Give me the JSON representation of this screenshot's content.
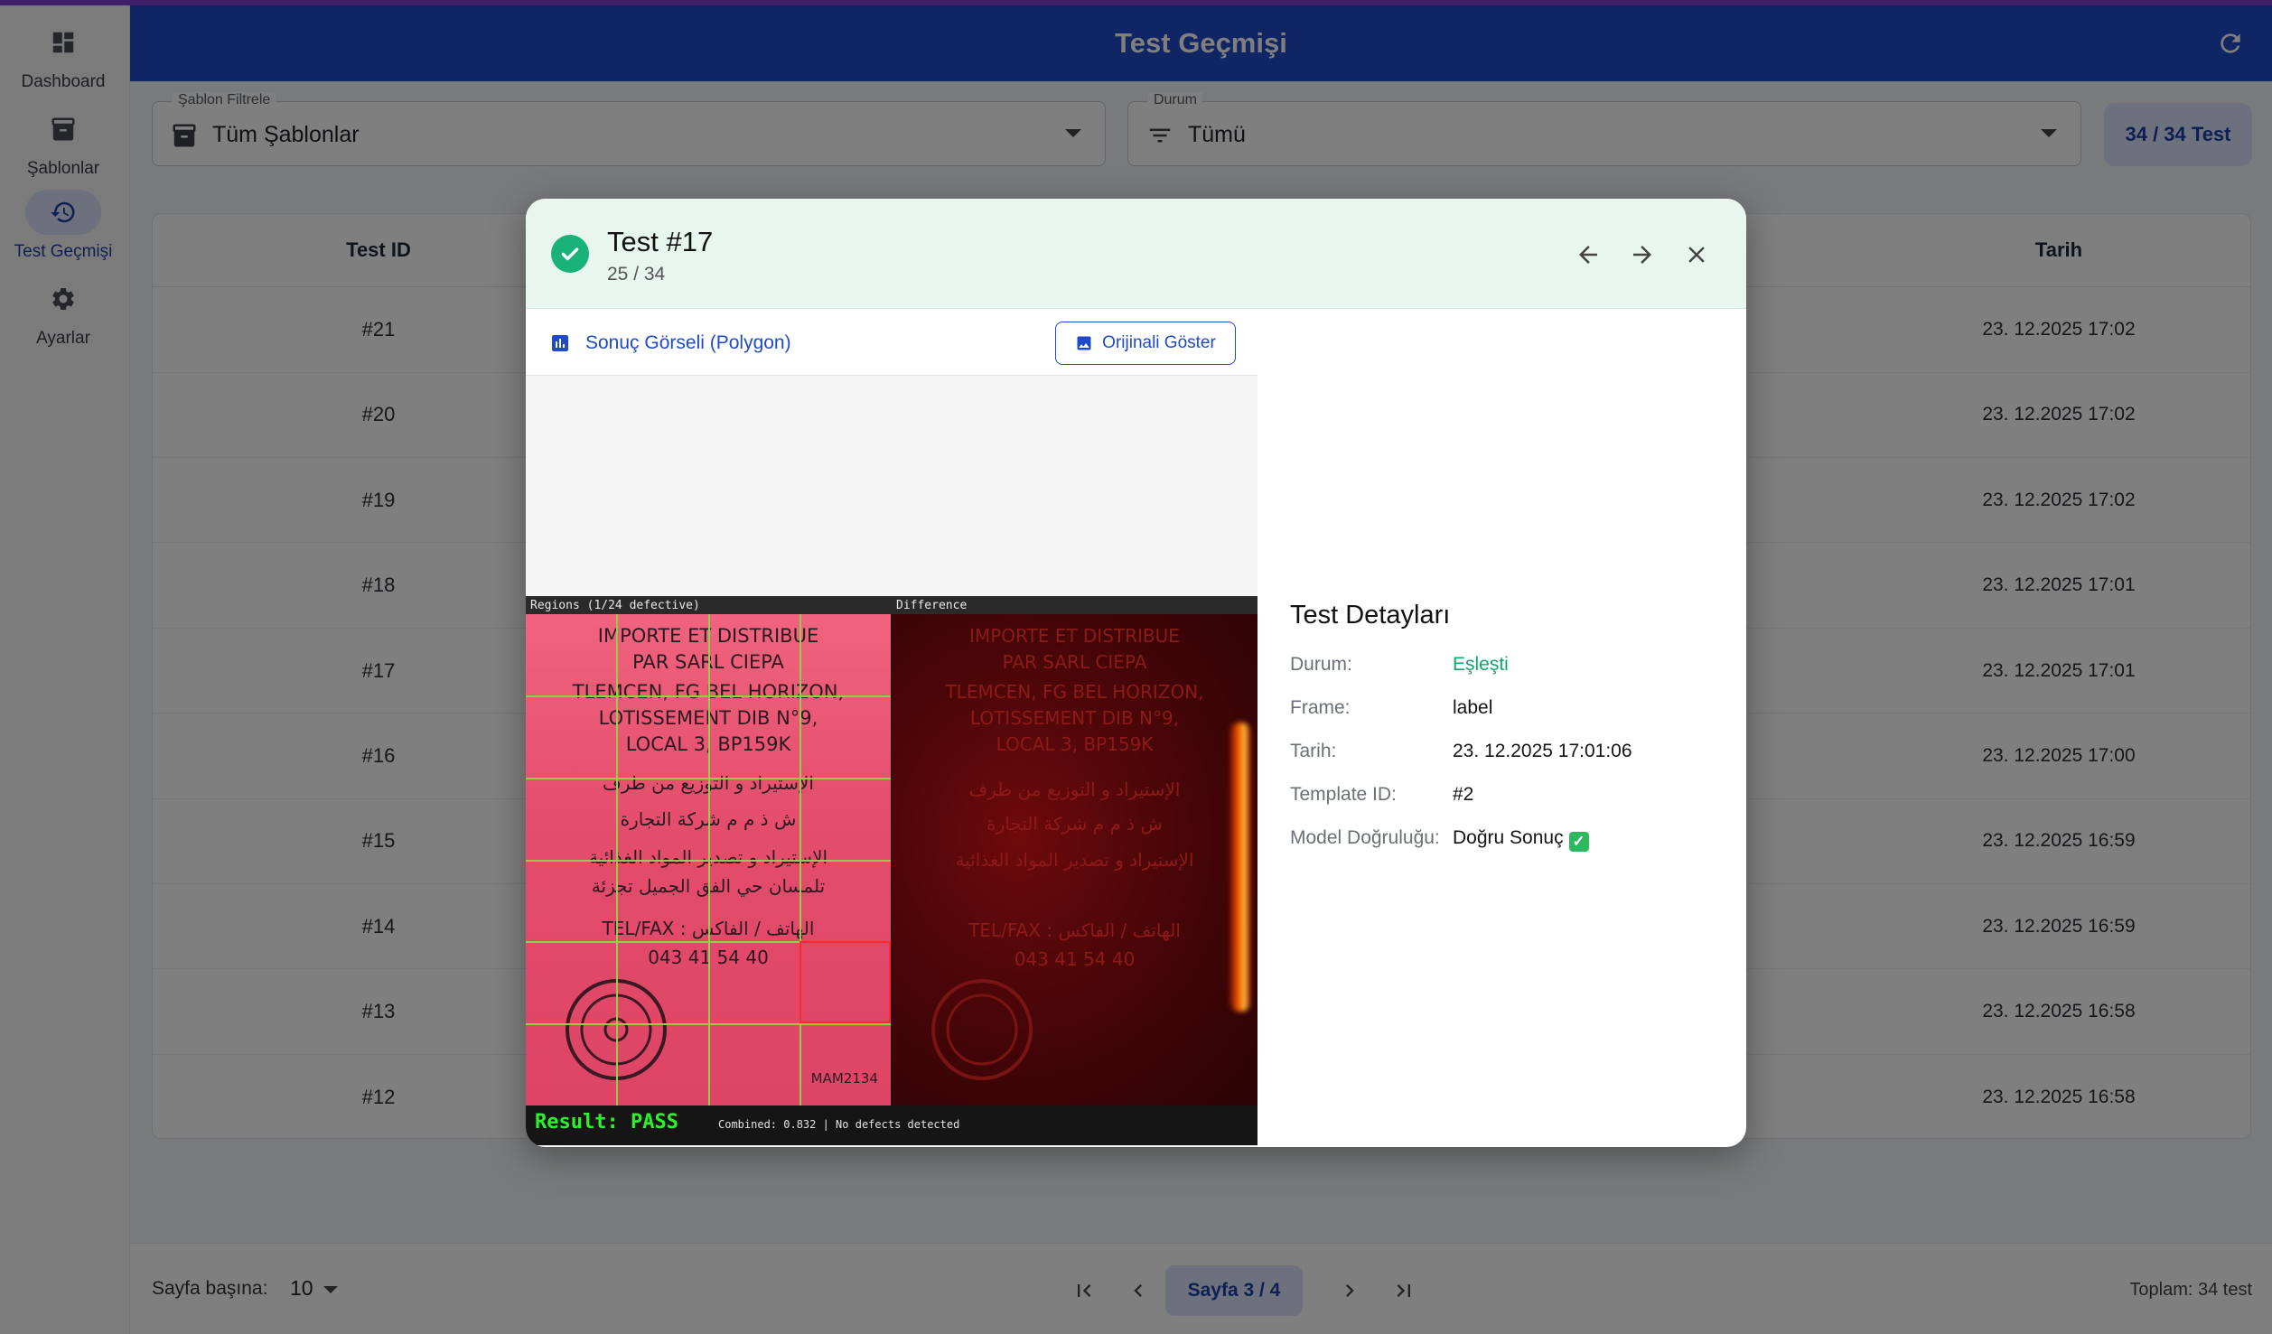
{
  "app": {
    "header_title": "Test Geçmişi"
  },
  "sidebar": {
    "items": [
      {
        "label": "Dashboard",
        "icon": "dashboard-icon",
        "active": false
      },
      {
        "label": "Şablonlar",
        "icon": "archive-icon",
        "active": false
      },
      {
        "label": "Test Geçmişi",
        "icon": "history-icon",
        "active": true
      },
      {
        "label": "Ayarlar",
        "icon": "gear-icon",
        "active": false
      }
    ]
  },
  "filters": {
    "template": {
      "label": "Şablon Filtrele",
      "value": "Tüm Şablonlar",
      "icon": "archive-icon"
    },
    "status": {
      "label": "Durum",
      "value": "Tümü",
      "icon": "filter-icon"
    },
    "count_chip": "34 / 34 Test"
  },
  "table": {
    "columns": [
      "Test ID",
      "Tarih"
    ],
    "rows": [
      {
        "id": "#21",
        "date": "23. 12.2025 17:02"
      },
      {
        "id": "#20",
        "date": "23. 12.2025 17:02"
      },
      {
        "id": "#19",
        "date": "23. 12.2025 17:02"
      },
      {
        "id": "#18",
        "date": "23. 12.2025 17:01"
      },
      {
        "id": "#17",
        "date": "23. 12.2025 17:01"
      },
      {
        "id": "#16",
        "date": "23. 12.2025 17:00"
      },
      {
        "id": "#15",
        "date": "23. 12.2025 16:59"
      },
      {
        "id": "#14",
        "date": "23. 12.2025 16:59"
      },
      {
        "id": "#13",
        "date": "23. 12.2025 16:58"
      },
      {
        "id": "#12",
        "date": "23. 12.2025 16:58"
      }
    ]
  },
  "pagination": {
    "per_page_label": "Sayfa başına:",
    "per_page_value": "10",
    "page_label": "Sayfa 3 / 4",
    "total": "Toplam:  34 test"
  },
  "modal": {
    "title": "Test #17",
    "subtitle": "25 / 34",
    "image_section_title": "Sonuç Görseli (Polygon)",
    "original_button": "Orijinali Göster",
    "image": {
      "left_caption": "Regions (1/24 defective)",
      "right_caption": "Difference",
      "result_text": "Result:  PASS",
      "combined_text": "Combined: 0.832 | No defects detected",
      "photo_lines": [
        "IMPORTE ET DISTRIBUE",
        "PAR SARL CIEPA",
        "TLEMCEN, FG BEL HORIZON,",
        "LOTISSEMENT DIB N°9,",
        "LOCAL 3, BP159K"
      ],
      "photo_arabic": [
        "الإستيراد و التوزيع من طرف",
        "ش ذ م م شركة التجارة",
        "الإستيراد و تصدير المواد الغذائية",
        "تلمسان حي الفق الجميل تجزئة"
      ],
      "photo_tel": "TEL/FAX : الهاتف / الفاكس",
      "photo_phone": "043 41 54 40",
      "photo_code": "MAM2134"
    },
    "details": {
      "title": "Test Detayları",
      "rows": [
        {
          "key": "Durum:",
          "value": "Eşleşti",
          "highlight": true
        },
        {
          "key": "Frame:",
          "value": "label"
        },
        {
          "key": "Tarih:",
          "value": "23. 12.2025 17:01:06"
        },
        {
          "key": "Template ID:",
          "value": "#2"
        },
        {
          "key": "Model Doğruluğu:",
          "value": "Doğru Sonuç"
        }
      ]
    }
  },
  "colors": {
    "header": "#1e4ac8",
    "accent": "#7e3fd2",
    "success": "#19b37a",
    "primary_text": "#1f4ac8"
  }
}
